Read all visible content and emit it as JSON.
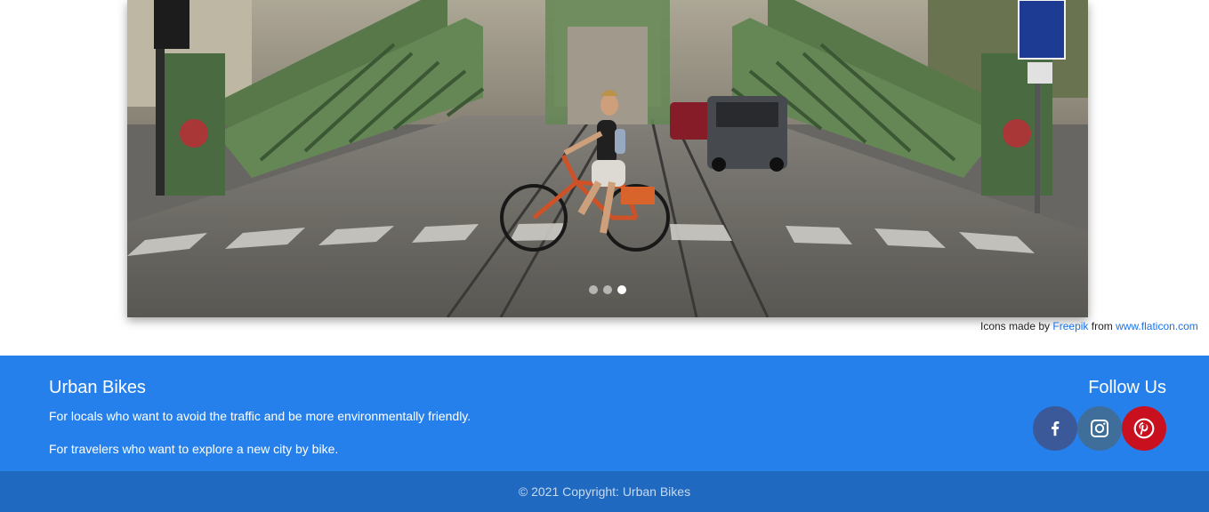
{
  "carousel": {
    "image_alt": "Cyclist riding an orange bike across a green steel bridge",
    "indicators": [
      "slide-1",
      "slide-2",
      "slide-3"
    ],
    "active_index": 2
  },
  "attribution": {
    "prefix": "Icons made by",
    "author": "Freepik",
    "middle": "from",
    "site": "www.flaticon.com"
  },
  "footer": {
    "brand_title": "Urban Bikes",
    "line1": "For locals who want to avoid the traffic and be more environmentally friendly.",
    "line2": "For travelers who want to explore a new city by bike.",
    "follow_title": "Follow Us",
    "social": [
      {
        "name": "facebook",
        "icon": "facebook-icon",
        "color": "#3b5998"
      },
      {
        "name": "instagram",
        "icon": "instagram-icon",
        "color": "#3f6e9b"
      },
      {
        "name": "pinterest",
        "icon": "pinterest-icon",
        "color": "#c8101f"
      }
    ],
    "copyright": "© 2021 Copyright: Urban Bikes"
  },
  "colors": {
    "footer_bg": "#2680eb",
    "link": "#1a73e8"
  }
}
